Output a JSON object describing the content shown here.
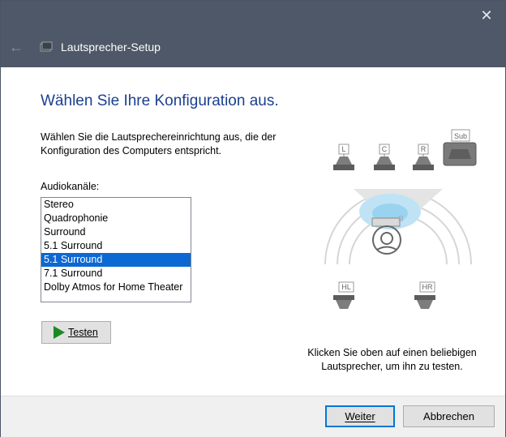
{
  "window": {
    "title": "Lautsprecher-Setup",
    "close_glyph": "✕",
    "back_glyph": "←"
  },
  "main": {
    "heading": "Wählen Sie Ihre Konfiguration aus.",
    "description": "Wählen Sie die Lautsprechereinrichtung aus, die der Konfiguration des Computers entspricht.",
    "list_label": "Audiokanäle:",
    "channels": [
      "Stereo",
      "Quadrophonie",
      "Surround",
      "5.1 Surround",
      "5.1 Surround",
      "7.1 Surround",
      "Dolby Atmos for Home Theater"
    ],
    "selected_index": 4,
    "test_button": "Testen",
    "hint": "Klicken Sie oben auf einen beliebigen Lautsprecher, um ihn zu testen."
  },
  "speakers": {
    "left": "L",
    "center": "C",
    "right": "R",
    "sub": "Sub",
    "rear_left": "HL",
    "rear_right": "HR"
  },
  "footer": {
    "next_button": "Weiter",
    "cancel_button": "Abbrechen"
  },
  "colors": {
    "titlebar": "#4e5868",
    "heading": "#1b3f8f",
    "selection": "#0c68d3",
    "primary_border": "#0078d7",
    "play_icon": "#1c8a22"
  }
}
